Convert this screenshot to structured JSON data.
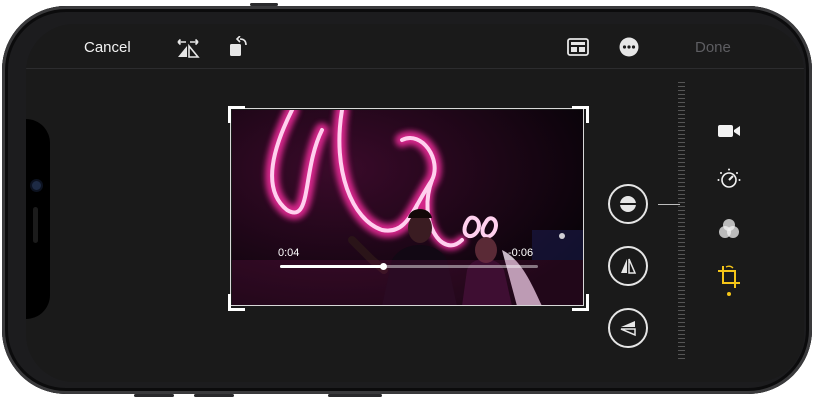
{
  "topbar": {
    "cancel_label": "Cancel",
    "done_label": "Done",
    "icons": [
      "flip-mirror-icon",
      "rotate-icon",
      "aspect-ratio-icon",
      "more-options-icon"
    ]
  },
  "video": {
    "elapsed": "0:04",
    "remaining": "-0:06",
    "progress": 0.4
  },
  "crop_tools": [
    "straighten-icon",
    "vertical-perspective-icon",
    "horizontal-perspective-icon"
  ],
  "right_tabs": [
    "video-icon",
    "adjust-icon",
    "filters-icon",
    "crop-icon"
  ],
  "colors": {
    "background": "#1a1a1a",
    "accent_dot": "#f5c518",
    "neon": "#ff2fa5"
  }
}
